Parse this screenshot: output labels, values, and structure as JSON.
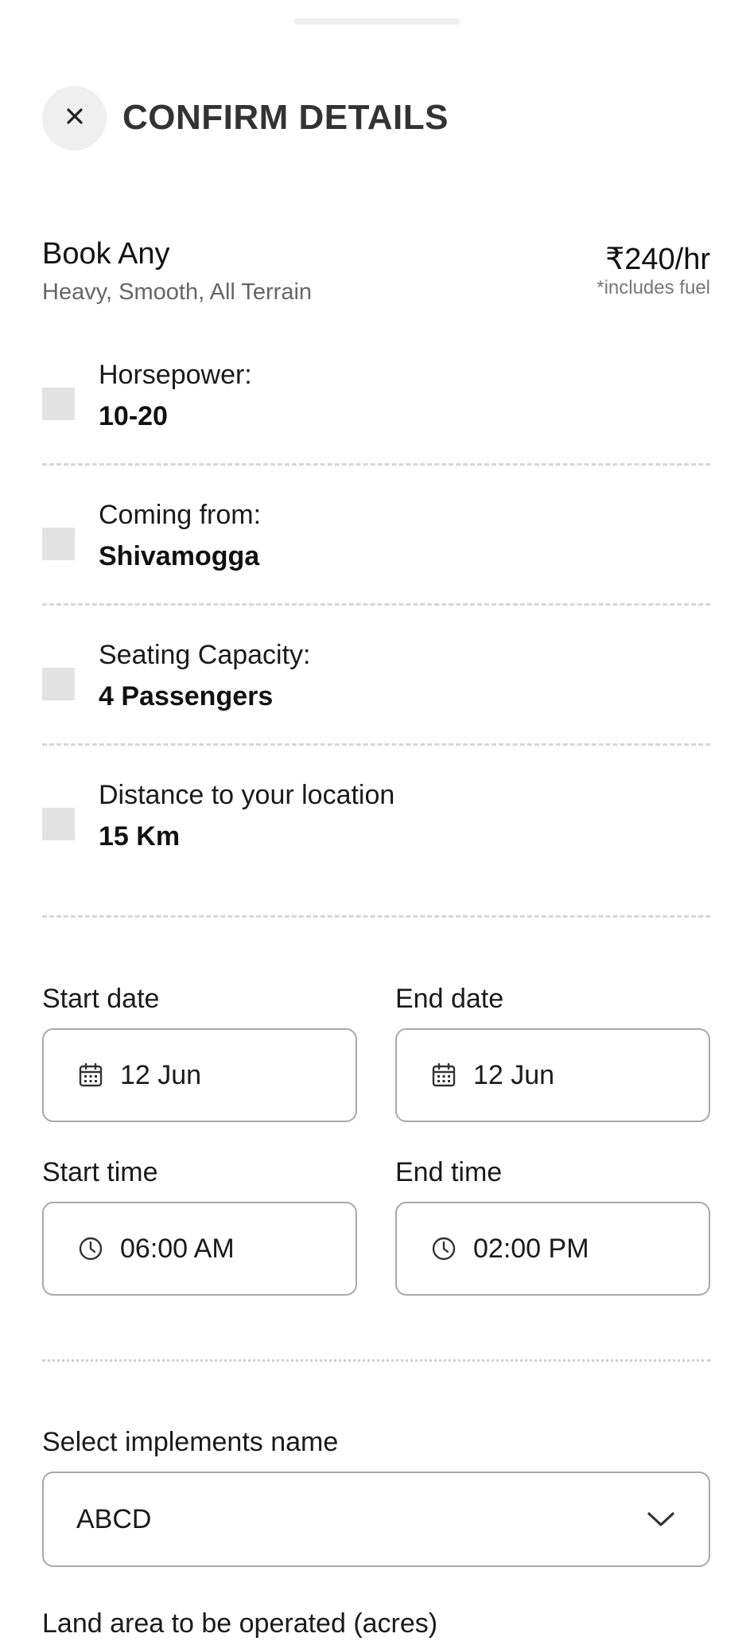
{
  "header": {
    "title": "CONFIRM DETAILS",
    "close_icon": "close-icon"
  },
  "booking": {
    "name": "Book Any",
    "subtitle": "Heavy, Smooth, All Terrain",
    "price": "₹240/hr",
    "price_note": "*includes fuel"
  },
  "specs": [
    {
      "label": "Horsepower:",
      "value": "10-20"
    },
    {
      "label": "Coming from:",
      "value": "Shivamogga"
    },
    {
      "label": "Seating Capacity:",
      "value": "4 Passengers"
    },
    {
      "label": "Distance to your location",
      "value": "15 Km"
    }
  ],
  "schedule": {
    "start_date_label": "Start date",
    "start_date": "12 Jun",
    "end_date_label": "End date",
    "end_date": "12 Jun",
    "start_time_label": "Start time",
    "start_time": "06:00 AM",
    "end_time_label": "End time",
    "end_time": "02:00 PM",
    "date_icon": "calendar-icon",
    "time_icon": "clock-icon"
  },
  "implements": {
    "label": "Select implements name",
    "selected": "ABCD",
    "chevron_icon": "chevron-down-icon"
  },
  "land_area": {
    "label": "Land area to be operated (acres)"
  },
  "colors": {
    "text_primary": "#1a1a1a",
    "text_secondary": "#666666",
    "border": "#a9a9a9",
    "placeholder_icon": "#e2e2e2",
    "close_bg": "#efefef"
  }
}
